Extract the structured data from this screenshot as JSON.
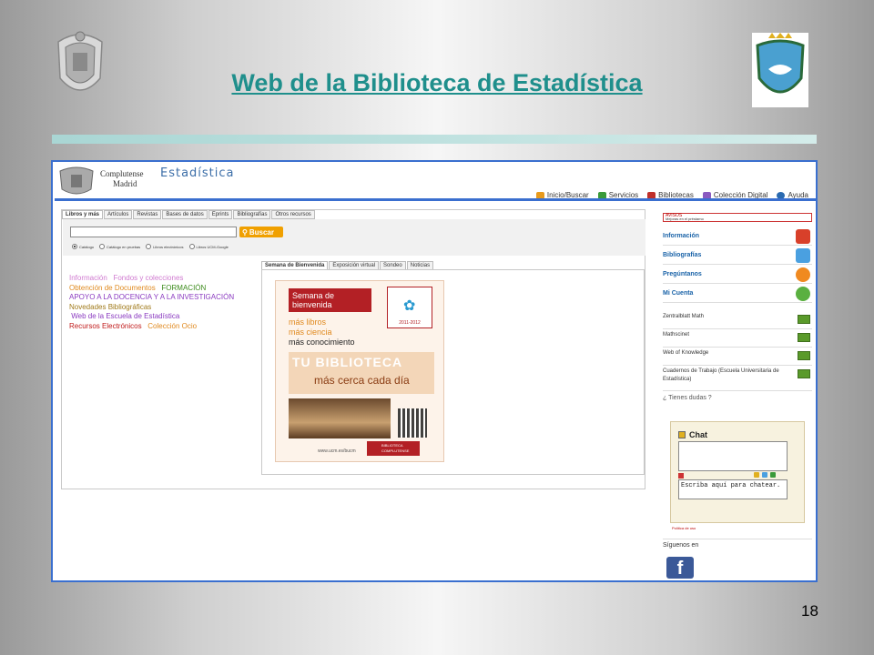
{
  "slide": {
    "title": "Web de la Biblioteca de Estadística",
    "page_number": "18"
  },
  "site": {
    "brand_line1": "Complutense",
    "brand_line2": "Madrid",
    "name": "Estadística",
    "nav": [
      {
        "label": "Inicio/Buscar",
        "icon": "search-icon",
        "color": "#e89a1c"
      },
      {
        "label": "Servicios",
        "icon": "services-icon",
        "color": "#3a9a3a"
      },
      {
        "label": "Bibliotecas",
        "icon": "library-icon",
        "color": "#c0302a"
      },
      {
        "label": "Colección Digital",
        "icon": "digital-icon",
        "color": "#8a5ac0"
      },
      {
        "label": "Ayuda",
        "icon": "help-icon",
        "color": "#2a6ab0"
      }
    ]
  },
  "search": {
    "tabs": [
      "Libros y más",
      "Artículos",
      "Revistas",
      "Bases de datos",
      "Eprints",
      "Bibliografías",
      "Otros recursos"
    ],
    "button_label": "Buscar",
    "scopes": [
      "Catálogo",
      "Catálogo en pruebas",
      "Libros electrónicos",
      "Libros UCM-Google"
    ]
  },
  "links": [
    {
      "text": "Información",
      "color": "#d07ad0"
    },
    {
      "text": "Fondos y colecciones",
      "color": "#d07ad0"
    },
    {
      "text": "Obtención de Documentos",
      "color": "#e08a20"
    },
    {
      "text": "FORMACIÓN",
      "color": "#3a8a1a"
    },
    {
      "text": "APOYO A LA DOCENCIA Y A LA INVESTIGACIÓN",
      "color": "#8a3ac0"
    },
    {
      "text": "Novedades Bibliográficas",
      "color": "#a07a1a"
    },
    {
      "text": "Web de la Escuela de Estadística",
      "color": "#8a3ac0"
    },
    {
      "text": "Recursos Electrónicos",
      "color": "#c01a1a"
    },
    {
      "text": "Colección Ocio",
      "color": "#e08a20"
    }
  ],
  "welcome": {
    "tabs": [
      "Semana de Bienvenida",
      "Exposición virtual",
      "Sondeo",
      "Noticias"
    ],
    "poster_heading": "Semana de bienvenida",
    "poster_badge": "2011-2012",
    "poster_lines": [
      "más libros",
      "más ciencia",
      "más conocimiento"
    ],
    "poster_tu": "TU BIBLIOTECA",
    "poster_sub": "más cerca cada día",
    "poster_url": "www.ucm.es/bucm",
    "poster_bib": "BIBLIOTECA COMPLUTENSE"
  },
  "sidebar": {
    "avisos_title": "AVISOS",
    "avisos_text": "Mejoras en el préstamo",
    "blocks": [
      {
        "label": "Información",
        "icon": "info-icon",
        "color": "#d8402a"
      },
      {
        "label": "Bibliografías",
        "icon": "bibliography-icon",
        "color": "#4aa0e0"
      },
      {
        "label": "Pregúntanos",
        "icon": "question-icon",
        "color": "#f08a20"
      },
      {
        "label": "Mi Cuenta",
        "icon": "account-icon",
        "color": "#5ab040"
      }
    ],
    "resources": [
      "Zentralblatt Math",
      "Mathscinet",
      "Web of Knowledge",
      "Cuadernos de Trabajo (Escuela Universitaria de Estadística)"
    ],
    "dudas": "¿ Tienes dudas ?",
    "chat_title": "Chat",
    "chat_placeholder": "Escriba aquí para chatear.",
    "politica": "Política de uso",
    "siguenos": "Síguenos en"
  }
}
